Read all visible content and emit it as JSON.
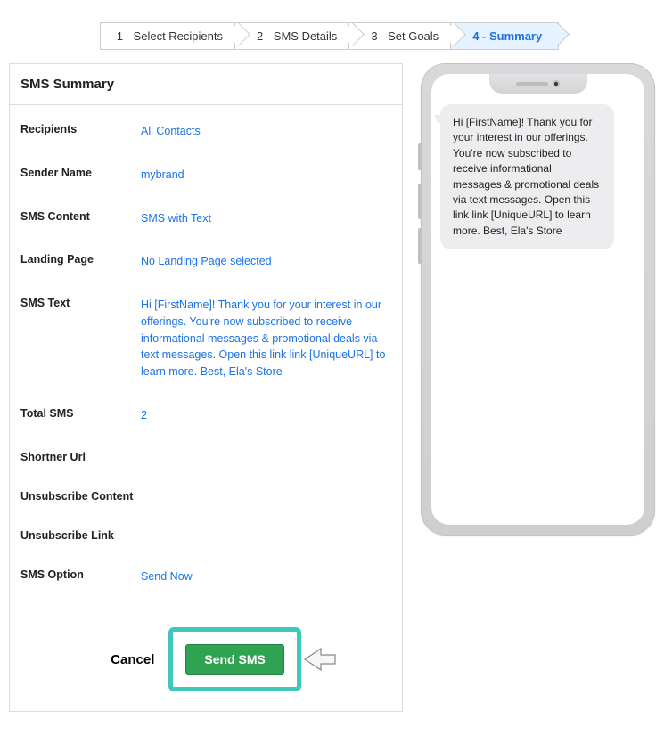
{
  "stepper": {
    "steps": [
      {
        "label": "1 - Select Recipients"
      },
      {
        "label": "2 - SMS Details"
      },
      {
        "label": "3 - Set Goals"
      },
      {
        "label": "4 - Summary"
      }
    ]
  },
  "summary": {
    "title": "SMS Summary",
    "rows": {
      "recipients": {
        "label": "Recipients",
        "value": "All Contacts"
      },
      "sender_name": {
        "label": "Sender Name",
        "value": "mybrand"
      },
      "sms_content": {
        "label": "SMS Content",
        "value": "SMS with Text"
      },
      "landing_page": {
        "label": "Landing Page",
        "value": "No Landing Page selected"
      },
      "sms_text": {
        "label": "SMS Text",
        "value": "Hi [FirstName]! Thank you for your interest in our offerings. You're now subscribed to receive informational messages & promotional deals via text messages. Open this link link [UniqueURL] to learn more. Best, Ela's Store"
      },
      "total_sms": {
        "label": "Total SMS",
        "value": "2"
      },
      "shortner_url": {
        "label": "Shortner Url",
        "value": ""
      },
      "unsubscribe_content": {
        "label": "Unsubscribe Content",
        "value": ""
      },
      "unsubscribe_link": {
        "label": "Unsubscribe Link",
        "value": ""
      },
      "sms_option": {
        "label": "SMS Option",
        "value": "Send Now"
      }
    }
  },
  "footer": {
    "cancel_label": "Cancel",
    "send_label": "Send SMS"
  },
  "preview": {
    "message": "Hi [FirstName]! Thank you for your interest in our offerings. You're now subscribed to receive informational messages & promotional deals via text messages. Open this link link [UniqueURL] to learn more. Best, Ela's Store"
  }
}
